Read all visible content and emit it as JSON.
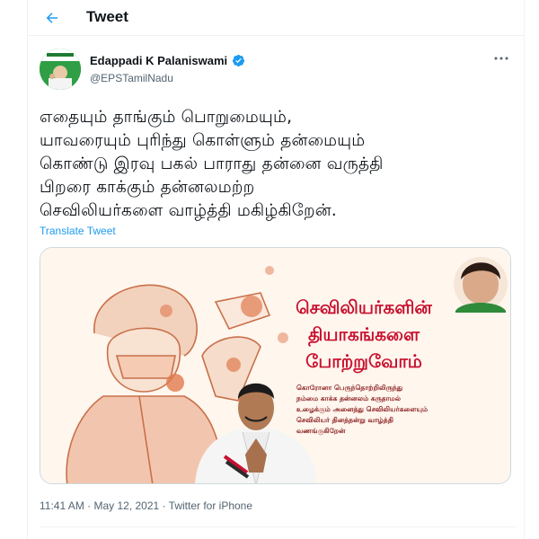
{
  "header": {
    "title": "Tweet"
  },
  "author": {
    "name": "Edappadi K Palaniswami",
    "handle": "@EPSTamilNadu"
  },
  "tweet": {
    "lines": [
      "எதையும் தாங்கும் பொறுமையும்,",
      "யாவரையும் புரிந்து கொள்ளும் தன்மையும்",
      "கொண்டு இரவு பகல் பாராது தன்னை வருத்தி",
      "பிறரை காக்கும் தன்னலமற்ற",
      "செவிலியர்களை வாழ்த்தி மகிழ்கிறேன்."
    ],
    "translate_label": "Translate Tweet"
  },
  "media": {
    "headline": [
      "செவிலியர்களின்",
      "தியாகங்களை",
      "போற்றுவோம்"
    ],
    "body": [
      "கொரோனா பெருந்தொற்றிலிருந்து",
      "நம்மை காக்க தன்னலம் கருதாமல்",
      "உழைக்கும் அனைத்து செவிலியர்களையும்",
      "செவிலியர் தினத்தன்று வாழ்த்தி",
      "வணங்குகிறேன்"
    ]
  },
  "meta": {
    "time": "11:41 AM",
    "date": "May 12, 2021",
    "source": "Twitter for iPhone",
    "separator": " · "
  },
  "colors": {
    "accent": "#1d9bf0",
    "poster_red": "#c8102e",
    "poster_bg": "#fff6ee"
  },
  "icons": {
    "back": "arrow-left-icon",
    "verified": "verified-badge-icon",
    "more": "more-horizontal-icon"
  }
}
